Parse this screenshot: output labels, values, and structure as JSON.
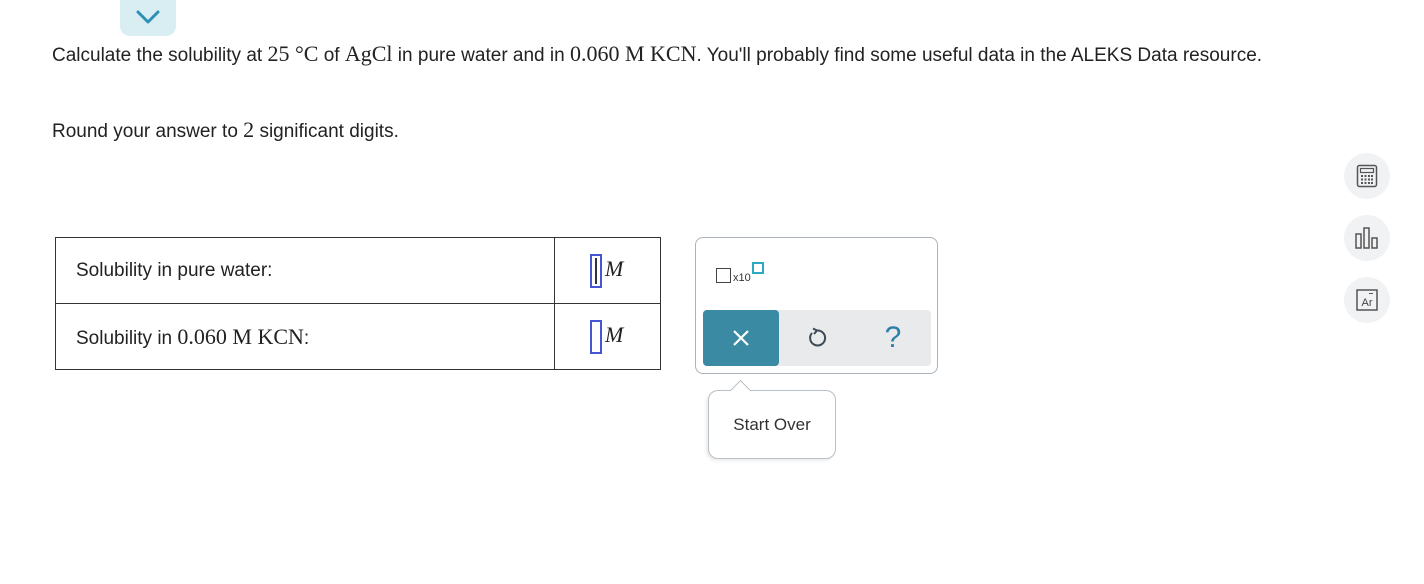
{
  "question": {
    "text_part1": "Calculate the solubility at ",
    "temperature": "25 °C",
    "text_part2": " of ",
    "compound": "AgCl",
    "text_part3": " in pure water and in ",
    "solution": "0.060 M KCN",
    "text_part4": ". You'll probably find some useful data in the ALEKS Data resource."
  },
  "instruction": {
    "prefix": "Round your answer to ",
    "digits": "2",
    "suffix": " significant digits."
  },
  "answer_table": {
    "rows": [
      {
        "label": "Solubility in pure water:",
        "label_math": "",
        "unit": "M",
        "value": ""
      },
      {
        "label": "Solubility in ",
        "label_math": "0.060 M KCN",
        "label_suffix": ":",
        "unit": "M",
        "value": ""
      }
    ]
  },
  "keypad": {
    "sci_label": "x10",
    "clear_icon": "close-icon",
    "undo_icon": "undo-icon",
    "help_label": "?"
  },
  "tooltip": {
    "text": "Start Over"
  },
  "side_tools": [
    "calculator-icon",
    "chart-icon",
    "periodic-table-icon"
  ],
  "periodic_symbol": "Ar",
  "colors": {
    "accent": "#3a8aa3",
    "input_border": "#4655d4",
    "tab_bg": "#d9eef3",
    "exponent": "#2da9c0"
  }
}
